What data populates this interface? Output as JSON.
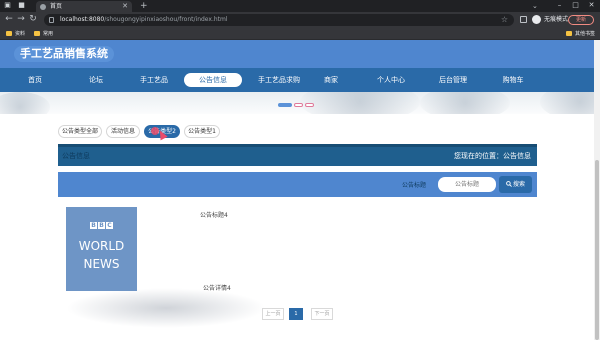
{
  "browser": {
    "tab_title": "首页",
    "url_host": "localhost:8080",
    "url_path": "/shougongyipinxiaoshou/front/index.html",
    "incognito_label": "无痕模式",
    "update_label": "更新",
    "bookmarks": [
      "资料",
      "常用"
    ],
    "other_bookmarks": "其他书签"
  },
  "site": {
    "title": "手工艺品销售系统"
  },
  "nav": {
    "items": [
      "首页",
      "论坛",
      "手工艺品",
      "公告信息",
      "手工艺品求购",
      "商家",
      "个人中心",
      "后台管理",
      "购物车"
    ],
    "active_index": 3
  },
  "filters": {
    "items": [
      "公告类型全部",
      "活动信息",
      "公告类型2",
      "公告类型1"
    ],
    "active_index": 2
  },
  "breadcrumb": {
    "section": "公告信息",
    "location": "您现在的位置：公告信息"
  },
  "search": {
    "label": "公告标题",
    "placeholder": "公告标题",
    "button": "搜索"
  },
  "announcement": {
    "title": "公告标题4",
    "detail": "公告详情4",
    "image_text": [
      "BBC",
      "WORLD",
      "NEWS"
    ]
  },
  "pagination": {
    "prev": "上一页",
    "current": "1",
    "next": "下一页"
  },
  "colors": {
    "header": "#4f86cf",
    "nav": "#2a6aa8",
    "breadcrumb": "#1f5f8e",
    "accent": "#2a6aa8"
  }
}
